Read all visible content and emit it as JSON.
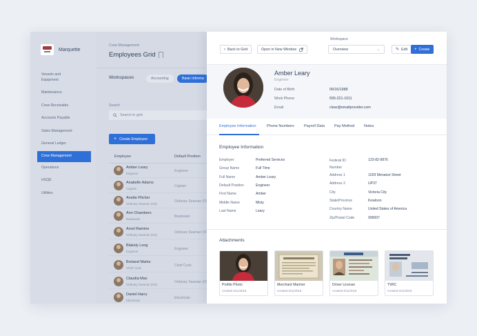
{
  "sidebar": {
    "brand": "Marquette",
    "items": [
      {
        "label": "Vessels and Equipment"
      },
      {
        "label": "Maintenance"
      },
      {
        "label": "Crew Receivable"
      },
      {
        "label": "Accounts Payable"
      },
      {
        "label": "Sales Management"
      },
      {
        "label": "General Ledger"
      },
      {
        "label": "Crew Management",
        "active": true
      },
      {
        "label": "Operations"
      },
      {
        "label": "HSQE"
      },
      {
        "label": "Utilities"
      }
    ]
  },
  "grid": {
    "breadcrumb": "Crew Management",
    "title": "Employees Grid",
    "workspaces_label": "Workspaces",
    "workspace_tabs": [
      "Accounting",
      "Basic Informa"
    ],
    "search_label": "Search",
    "search_placeholder": "Search in grid",
    "create_label": "Create Employee",
    "col_employee": "Employee",
    "col_position": "Default Position",
    "rows": [
      {
        "name": "Amber Leary",
        "role": "Engineer",
        "position": "Engineer"
      },
      {
        "name": "Anabelle Adams",
        "role": "Captain",
        "position": "Captain"
      },
      {
        "name": "Anette Pitcher",
        "role": "Ordinary Seaman (OS)",
        "position": "Ordinary Seaman (OS)"
      },
      {
        "name": "Ann Chambers",
        "role": "Boatswain",
        "position": "Boatswain"
      },
      {
        "name": "Arnel Ramine",
        "role": "Ordinary Seaman (OS)",
        "position": "Ordinary Seaman (OS)"
      },
      {
        "name": "Blakely Long",
        "role": "Engineer",
        "position": "Engineer"
      },
      {
        "name": "Breland Marks",
        "role": "Chief Cook",
        "position": "Chief Cook"
      },
      {
        "name": "Claudia Max",
        "role": "Ordinary Seaman (OS)",
        "position": "Ordinary Seaman (OS)"
      },
      {
        "name": "Daniel Harry",
        "role": "Electrician",
        "position": "Electrician"
      }
    ]
  },
  "detail": {
    "back_label": "Back to Grid",
    "open_label": "Open in New Window",
    "workspace_caption": "Workspace",
    "workspace_value": "Overview",
    "edit_label": "Edit",
    "create_label": "Create",
    "name": "Amber Leary",
    "role": "Engineer",
    "dob_label": "Date of Birth",
    "dob": "06/16/1988",
    "phone_label": "Work Phone",
    "phone": "555-221-1011",
    "email_label": "Email",
    "email": "clear@emailprovider.com",
    "tabs": [
      "Employee Information",
      "Phone Numbers",
      "Payroll Data",
      "Pay Method",
      "Notes"
    ],
    "section_title": "Employee Information",
    "left_fields": [
      {
        "label": "Employer",
        "value": "Preferred Services"
      },
      {
        "label": "Group Name",
        "value": "Full Time"
      },
      {
        "label": "Full Name",
        "value": "Amber Leary"
      },
      {
        "label": "Default Position",
        "value": "Engineer"
      },
      {
        "label": "First Name",
        "value": "Amber"
      },
      {
        "label": "Middle Name",
        "value": "Misty"
      },
      {
        "label": "Last Name",
        "value": "Leary"
      }
    ],
    "right_fields": [
      {
        "label": "Federal ID Number",
        "value": "123-82-9876"
      },
      {
        "label": "Address 1",
        "value": "1029 Menaturi Street"
      },
      {
        "label": "Address 2",
        "value": "UP37"
      },
      {
        "label": "City",
        "value": "Victoria City"
      },
      {
        "label": "State/Province",
        "value": "Kowloon"
      },
      {
        "label": "Country Name",
        "value": "United States of America"
      },
      {
        "label": "Zip/Postal Code",
        "value": "999007"
      }
    ],
    "attachments_title": "Attachments",
    "attachments": [
      {
        "title": "Profile Photo",
        "date": "Created 6/11/2018"
      },
      {
        "title": "Merchant Mariner",
        "date": "Created 6/11/2018"
      },
      {
        "title": "Driver License",
        "date": "Created 6/11/2018"
      },
      {
        "title": "TWIC",
        "date": "Created 6/11/2018"
      }
    ]
  }
}
